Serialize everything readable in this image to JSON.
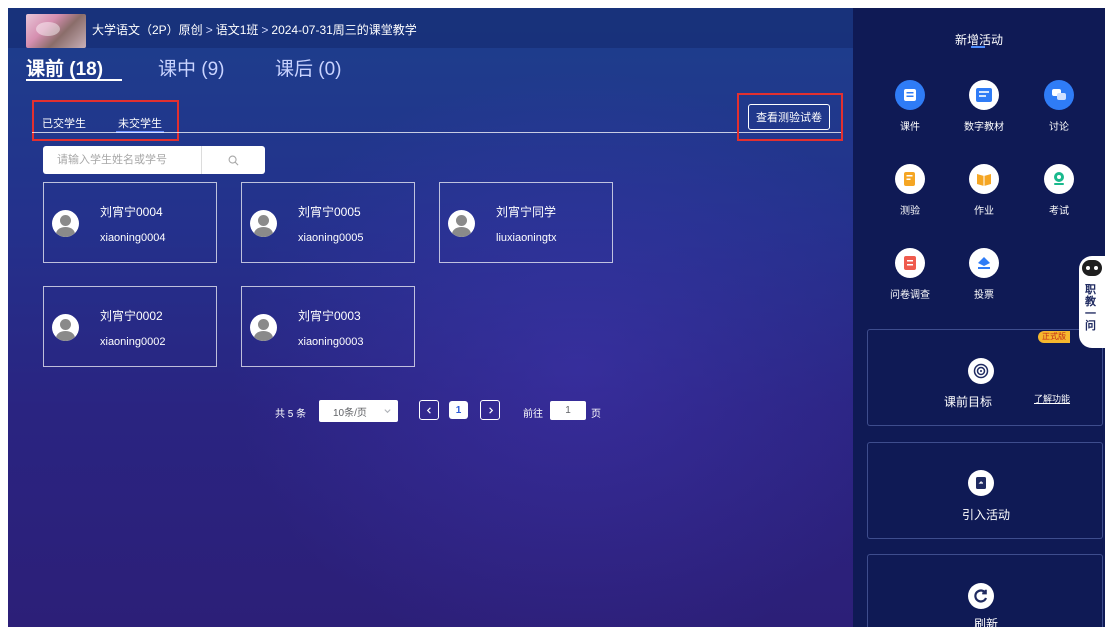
{
  "header": {
    "course": "大学语文（2P）原创",
    "class_name": "语文1班",
    "lesson": "2024-07-31周三的课堂教学",
    "separator": ">"
  },
  "phase_tabs": [
    {
      "label": "课前 (18)",
      "active": true
    },
    {
      "label": "课中 (9)",
      "active": false
    },
    {
      "label": "课后 (0)",
      "active": false
    }
  ],
  "submission_tabs": [
    {
      "label": "已交学生",
      "active": false
    },
    {
      "label": "未交学生",
      "active": true
    }
  ],
  "view_quiz_button": "查看测验试卷",
  "search": {
    "placeholder": "请输入学生姓名或学号",
    "value": "",
    "icon": "search-icon"
  },
  "students": [
    {
      "name": "刘宵宁0004",
      "account": "xiaoning0004"
    },
    {
      "name": "刘宵宁0005",
      "account": "xiaoning0005"
    },
    {
      "name": "刘宵宁同学",
      "account": "liuxiaoningtx"
    },
    {
      "name": "刘宵宁0002",
      "account": "xiaoning0002"
    },
    {
      "name": "刘宵宁0003",
      "account": "xiaoning0003"
    }
  ],
  "pagination": {
    "total_text": "共 5 条",
    "page_size": "10条/页",
    "current_page": "1",
    "goto_prefix": "前往",
    "goto_value": "1",
    "goto_suffix": "页"
  },
  "sidebar": {
    "title": "新增活动",
    "activities": [
      {
        "label": "课件",
        "icon": "courseware-icon",
        "color": "#2f7cf6"
      },
      {
        "label": "数字教材",
        "icon": "digital-textbook-icon",
        "color": "#2f7cf6"
      },
      {
        "label": "讨论",
        "icon": "discussion-icon",
        "color": "#2f7cf6"
      },
      {
        "label": "测验",
        "icon": "quiz-icon",
        "color": "#f5a623"
      },
      {
        "label": "作业",
        "icon": "homework-icon",
        "color": "#f5a623"
      },
      {
        "label": "考试",
        "icon": "exam-icon",
        "color": "#19b98d"
      },
      {
        "label": "问卷调查",
        "icon": "survey-icon",
        "color": "#ef5a4c"
      },
      {
        "label": "投票",
        "icon": "vote-icon",
        "color": "#2f7cf6"
      }
    ],
    "panels": [
      {
        "label": "课前目标",
        "icon": "target-icon",
        "link": "了解功能"
      },
      {
        "label": "引入活动",
        "icon": "import-icon"
      },
      {
        "label": "刷新",
        "icon": "refresh-icon"
      }
    ]
  },
  "assistant": {
    "text": "职教一问",
    "badge": "正式版"
  }
}
